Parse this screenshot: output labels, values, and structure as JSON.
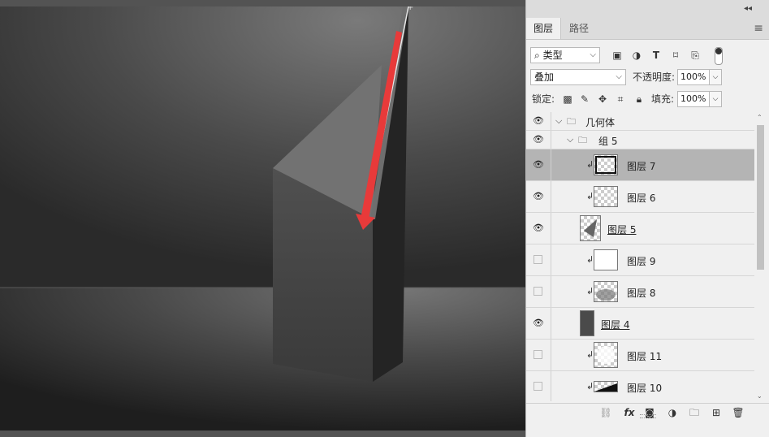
{
  "panel": {
    "tabs": [
      "图层",
      "路径"
    ],
    "filter": {
      "label": "类型"
    },
    "blend_mode": "叠加",
    "opacity": {
      "label": "不透明度:",
      "value": "100%"
    },
    "lock": {
      "label": "锁定:"
    },
    "fill": {
      "label": "填充:",
      "value": "100%"
    }
  },
  "layers": [
    {
      "name": "几何体",
      "type": "group",
      "visible": true,
      "indent": 0
    },
    {
      "name": "组 5",
      "type": "group",
      "visible": true,
      "indent": 1
    },
    {
      "name": "图层 7",
      "type": "layer",
      "visible": true,
      "clipped": true,
      "selected": true
    },
    {
      "name": "图层 6",
      "type": "layer",
      "visible": true,
      "clipped": true
    },
    {
      "name": "图层 5",
      "type": "layer",
      "visible": true,
      "clipped": false
    },
    {
      "name": "图层 9",
      "type": "layer",
      "visible": false,
      "clipped": true
    },
    {
      "name": "图层 8",
      "type": "layer",
      "visible": false,
      "clipped": true
    },
    {
      "name": "图层 4",
      "type": "layer",
      "visible": true,
      "clipped": false
    },
    {
      "name": "图层 11",
      "type": "layer",
      "visible": false,
      "clipped": true
    },
    {
      "name": "图层 10",
      "type": "layer",
      "visible": false,
      "clipped": true
    }
  ],
  "icons": {
    "search": "search-icon",
    "image_filter": "image-filter-icon",
    "adjust_filter": "adjustment-filter-icon",
    "text_filter": "type-filter-icon",
    "shape_filter": "shape-filter-icon",
    "smart_filter": "smart-object-filter-icon",
    "link": "link-icon",
    "fx": "fx",
    "mask": "mask-icon",
    "adjust": "adjustment-icon",
    "folder": "folder-icon",
    "new": "new-layer-icon",
    "trash": "trash-icon"
  },
  "colors": {
    "accent": "#e83a3a",
    "panel_bg": "#f0f0f0",
    "selected_row": "#b4b4b4"
  }
}
